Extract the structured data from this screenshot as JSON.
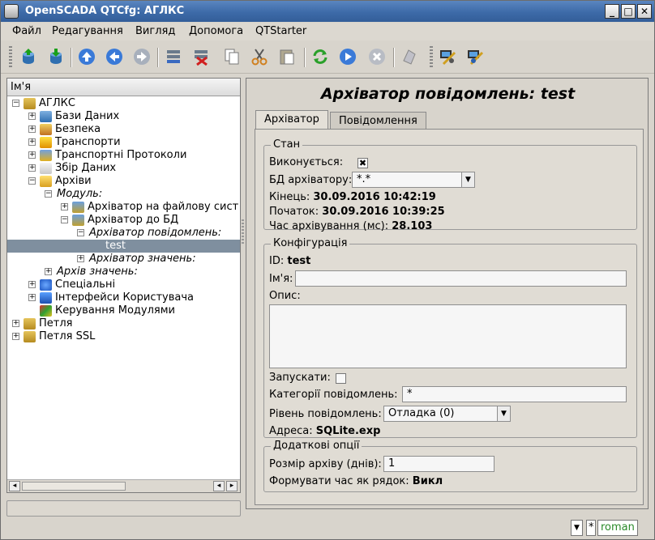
{
  "window": {
    "title": "OpenSCADA QTCfg: АГЛКС"
  },
  "menu": [
    "Файл",
    "Редагування",
    "Вигляд",
    "Допомога",
    "QTStarter"
  ],
  "toolbar": {
    "icons": [
      "db-load-icon",
      "db-save-icon",
      "up-icon",
      "back-icon",
      "forward-icon",
      "add-item-icon",
      "delete-item-icon",
      "copy-icon",
      "cut-icon",
      "paste-icon",
      "refresh-icon",
      "start-icon",
      "stop-icon",
      "info-icon",
      "module-a-icon",
      "module-b-icon"
    ]
  },
  "tree": {
    "header": "Ім'я",
    "items": [
      {
        "label": "АГЛКС",
        "level": 0,
        "expander": "−",
        "italic": false,
        "icon": "folder"
      },
      {
        "label": "Бази Даних",
        "level": 1,
        "expander": "+",
        "italic": false,
        "icon": "database"
      },
      {
        "label": "Безпека",
        "level": 1,
        "expander": "+",
        "italic": false,
        "icon": "security"
      },
      {
        "label": "Транспорти",
        "level": 1,
        "expander": "+",
        "italic": false,
        "icon": "lightning"
      },
      {
        "label": "Транспортні Протоколи",
        "level": 1,
        "expander": "+",
        "italic": false,
        "icon": "protocol"
      },
      {
        "label": "Збір Даних",
        "level": 1,
        "expander": "+",
        "italic": false,
        "icon": "chart"
      },
      {
        "label": "Архіви",
        "level": 1,
        "expander": "−",
        "italic": false,
        "icon": "archive"
      },
      {
        "label": "Модуль:",
        "level": 2,
        "expander": "−",
        "italic": true,
        "icon": ""
      },
      {
        "label": "Архіватор на файлову сист",
        "level": 3,
        "expander": "+",
        "italic": false,
        "icon": "module"
      },
      {
        "label": "Архіватор до БД",
        "level": 3,
        "expander": "−",
        "italic": false,
        "icon": "module"
      },
      {
        "label": "Архіватор повідомлень:",
        "level": 4,
        "expander": "−",
        "italic": true,
        "icon": ""
      },
      {
        "label": "test",
        "level": 5,
        "expander": "",
        "italic": false,
        "icon": "",
        "selected": true
      },
      {
        "label": "Архіватор значень:",
        "level": 4,
        "expander": "+",
        "italic": true,
        "icon": ""
      },
      {
        "label": "Архів значень:",
        "level": 2,
        "expander": "+",
        "italic": true,
        "icon": ""
      },
      {
        "label": "Спеціальні",
        "level": 1,
        "expander": "+",
        "italic": false,
        "icon": "help"
      },
      {
        "label": "Інтерфейси Користувача",
        "level": 1,
        "expander": "+",
        "italic": false,
        "icon": "monitor"
      },
      {
        "label": "Керування Модулями",
        "level": 1,
        "expander": "",
        "italic": false,
        "icon": "gems"
      },
      {
        "label": "Петля",
        "level": 0,
        "expander": "+",
        "italic": false,
        "icon": "folder"
      },
      {
        "label": "Петля SSL",
        "level": 0,
        "expander": "+",
        "italic": false,
        "icon": "folder"
      }
    ]
  },
  "page": {
    "title": "Архіватор повідомлень: test",
    "tabs": [
      {
        "label": "Архіватор",
        "active": true
      },
      {
        "label": "Повідомлення",
        "active": false
      }
    ],
    "state": {
      "group_title": "Стан",
      "running_label": "Виконується:",
      "running_checked": true,
      "db_label": "БД архіватору:",
      "db_value": "*.*",
      "end_label": "Кінець:",
      "end_value": "30.09.2016 10:42:19",
      "begin_label": "Початок:",
      "begin_value": "30.09.2016 10:39:25",
      "time_label": "Час архівування (мс):",
      "time_value": "28.103"
    },
    "config": {
      "group_title": "Конфігурація",
      "id_label": "ID:",
      "id_value": "test",
      "name_label": "Ім'я:",
      "name_value": "",
      "descr_label": "Опис:",
      "descr_value": "",
      "start_label": "Запускати:",
      "start_checked": false,
      "categories_label": "Категорії повідомлень:",
      "categories_value": "*",
      "level_label": "Рівень повідомлень:",
      "level_value": "Отладка (0)",
      "address_label": "Адреса:",
      "address_value": "SQLite.exp"
    },
    "extra": {
      "group_title": "Додаткові опції",
      "size_label": "Розмір архіву (днів):",
      "size_value": "1",
      "timestr_label": "Формувати час як рядок:",
      "timestr_value": "Викл"
    }
  },
  "status": {
    "user": "roman",
    "modified_mark": "*"
  }
}
